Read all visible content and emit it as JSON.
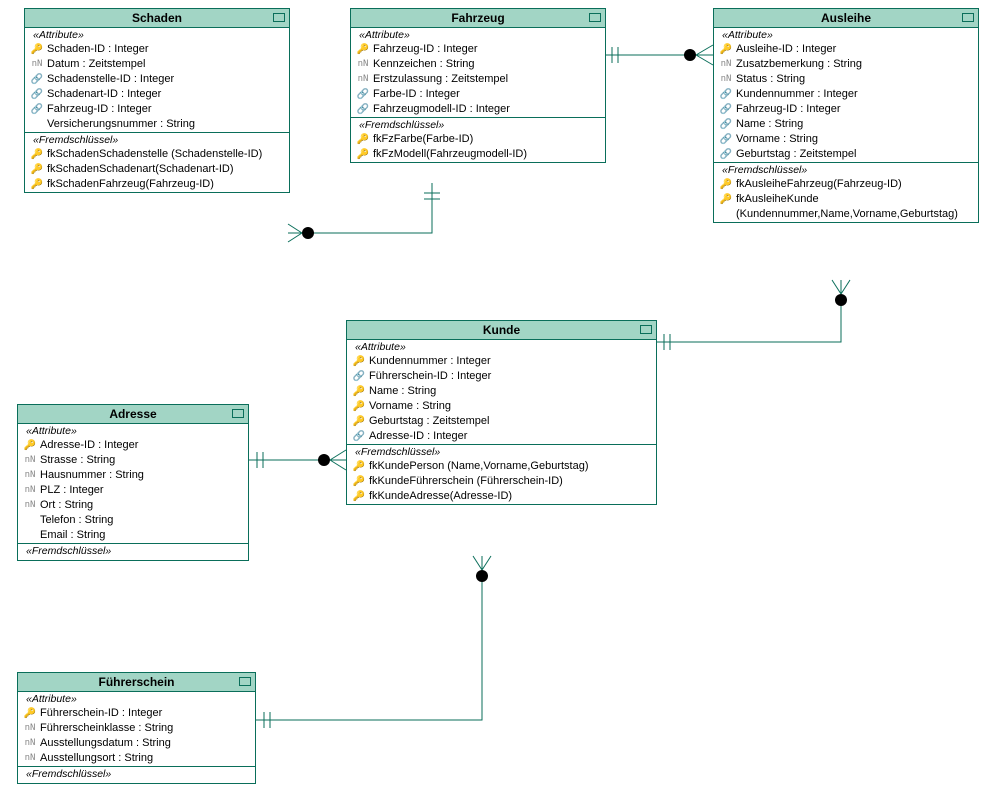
{
  "entities": {
    "schaden": {
      "title": "Schaden",
      "attr_label": "«Attribute»",
      "fk_label": "«Fremdschlüssel»",
      "attrs": [
        {
          "icon": "pk",
          "text": "Schaden-ID : Integer"
        },
        {
          "icon": "nn",
          "text": "Datum : Zeitstempel"
        },
        {
          "icon": "ln",
          "text": "Schadenstelle-ID : Integer"
        },
        {
          "icon": "ln",
          "text": "Schadenart-ID : Integer"
        },
        {
          "icon": "ln",
          "text": "Fahrzeug-ID : Integer"
        },
        {
          "icon": "",
          "text": "Versicherungsnummer : String"
        }
      ],
      "fks": [
        {
          "icon": "fk",
          "text": "fkSchadenSchadenstelle (Schadenstelle-ID)"
        },
        {
          "icon": "fk",
          "text": "fkSchadenSchadenart(Schadenart-ID)"
        },
        {
          "icon": "fk",
          "text": "fkSchadenFahrzeug(Fahrzeug-ID)"
        }
      ]
    },
    "fahrzeug": {
      "title": "Fahrzeug",
      "attr_label": "«Attribute»",
      "fk_label": "«Fremdschlüssel»",
      "attrs": [
        {
          "icon": "pk",
          "text": "Fahrzeug-ID : Integer"
        },
        {
          "icon": "nn",
          "text": "Kennzeichen : String"
        },
        {
          "icon": "nn",
          "text": "Erstzulassung : Zeitstempel"
        },
        {
          "icon": "ln",
          "text": "Farbe-ID : Integer"
        },
        {
          "icon": "ln",
          "text": "Fahrzeugmodell-ID : Integer"
        }
      ],
      "fks": [
        {
          "icon": "fk",
          "text": "fkFzFarbe(Farbe-ID)"
        },
        {
          "icon": "fk",
          "text": "fkFzModell(Fahrzeugmodell-ID)"
        }
      ]
    },
    "ausleihe": {
      "title": "Ausleihe",
      "attr_label": "«Attribute»",
      "fk_label": "«Fremdschlüssel»",
      "attrs": [
        {
          "icon": "pk",
          "text": "Ausleihe-ID : Integer"
        },
        {
          "icon": "nn",
          "text": "Zusatzbemerkung : String"
        },
        {
          "icon": "nn",
          "text": "Status : String"
        },
        {
          "icon": "ln",
          "text": "Kundennummer : Integer"
        },
        {
          "icon": "ln",
          "text": "Fahrzeug-ID : Integer"
        },
        {
          "icon": "ln",
          "text": "Name : String"
        },
        {
          "icon": "ln",
          "text": "Vorname : String"
        },
        {
          "icon": "ln",
          "text": "Geburtstag : Zeitstempel"
        }
      ],
      "fks": [
        {
          "icon": "fk",
          "text": "fkAusleiheFahrzeug(Fahrzeug-ID)"
        },
        {
          "icon": "fk",
          "text": "fkAusleiheKunde (Kundennummer,Name,Vorname,Geburtstag)"
        }
      ]
    },
    "kunde": {
      "title": "Kunde",
      "attr_label": "«Attribute»",
      "fk_label": "«Fremdschlüssel»",
      "attrs": [
        {
          "icon": "pk",
          "text": "Kundennummer : Integer"
        },
        {
          "icon": "ln",
          "text": "Führerschein-ID : Integer"
        },
        {
          "icon": "pk2",
          "text": "Name : String"
        },
        {
          "icon": "pk2",
          "text": "Vorname : String"
        },
        {
          "icon": "pk2",
          "text": "Geburtstag : Zeitstempel"
        },
        {
          "icon": "ln",
          "text": "Adresse-ID : Integer"
        }
      ],
      "fks": [
        {
          "icon": "fk",
          "text": "fkKundePerson (Name,Vorname,Geburtstag)"
        },
        {
          "icon": "fk",
          "text": "fkKundeFührerschein (Führerschein-ID)"
        },
        {
          "icon": "fk",
          "text": "fkKundeAdresse(Adresse-ID)"
        }
      ]
    },
    "adresse": {
      "title": "Adresse",
      "attr_label": "«Attribute»",
      "fk_label": "«Fremdschlüssel»",
      "attrs": [
        {
          "icon": "pk",
          "text": "Adresse-ID : Integer"
        },
        {
          "icon": "nn",
          "text": "Strasse : String"
        },
        {
          "icon": "nn",
          "text": "Hausnummer : String"
        },
        {
          "icon": "nn",
          "text": "PLZ : Integer"
        },
        {
          "icon": "nn",
          "text": "Ort : String"
        },
        {
          "icon": "",
          "text": "Telefon : String"
        },
        {
          "icon": "",
          "text": "Email : String"
        }
      ],
      "fks": []
    },
    "fuehrerschein": {
      "title": "Führerschein",
      "attr_label": "«Attribute»",
      "fk_label": "«Fremdschlüssel»",
      "attrs": [
        {
          "icon": "pk",
          "text": "Führerschein-ID : Integer"
        },
        {
          "icon": "nn",
          "text": "Führerscheinklasse : String"
        },
        {
          "icon": "nn",
          "text": "Ausstellungsdatum : String"
        },
        {
          "icon": "nn",
          "text": "Ausstellungsort : String"
        }
      ],
      "fks": []
    }
  }
}
